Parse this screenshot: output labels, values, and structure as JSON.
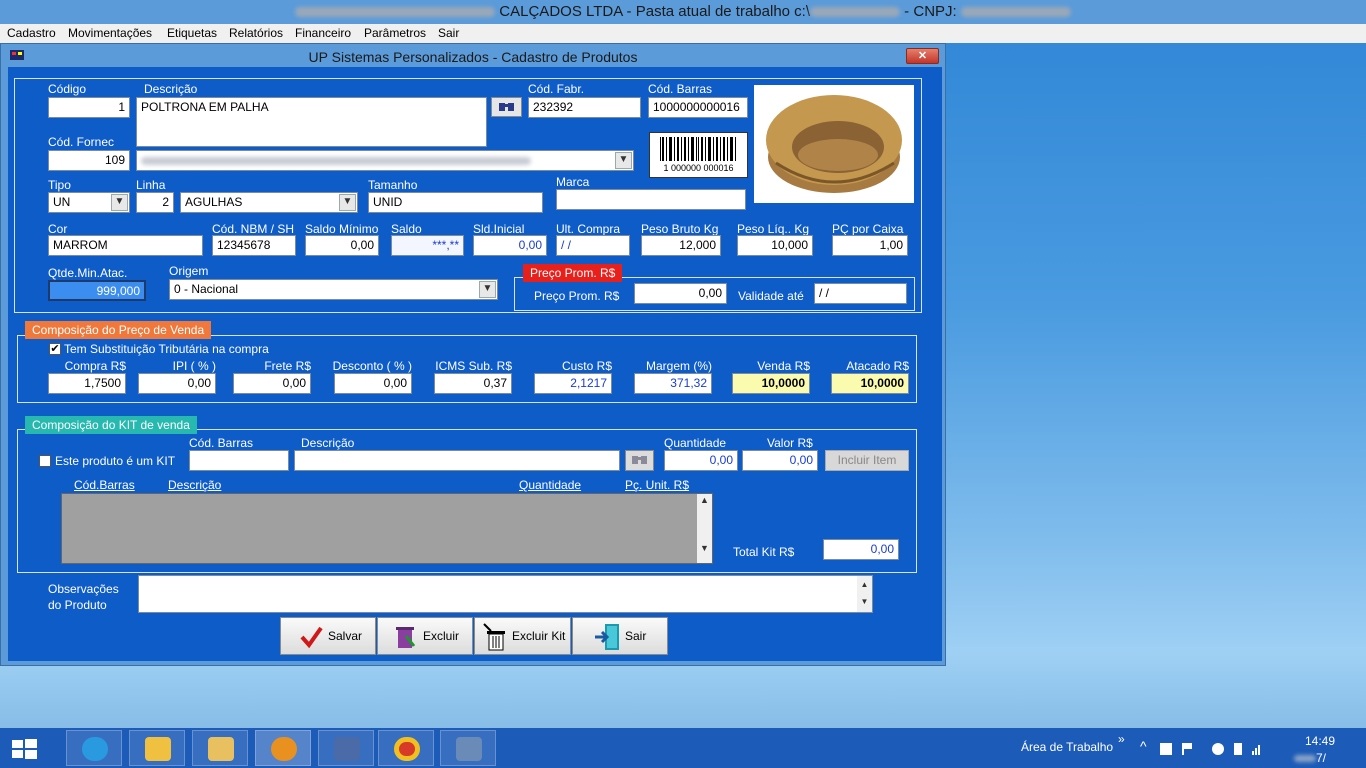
{
  "window": {
    "title_company": "CALÇADOS LTDA",
    "title_path_label": "Pasta atual de trabalho c:\\",
    "title_cnpj_label": "CNPJ:"
  },
  "menu": [
    "Cadastro",
    "Movimentações",
    "Etiquetas",
    "Relatórios",
    "Financeiro",
    "Parâmetros",
    "Sair"
  ],
  "dialog": {
    "title": "UP Sistemas Personalizados - Cadastro de Produtos",
    "close": "✕"
  },
  "product": {
    "codigo_label": "Código",
    "codigo": "1",
    "descricao_label": "Descrição",
    "descricao": "POLTRONA EM PALHA",
    "cod_fabr_label": "Cód. Fabr.",
    "cod_fabr": "232392",
    "cod_barras_label": "Cód. Barras",
    "cod_barras": "1000000000016",
    "barcode_text": "1 000000 000016",
    "cod_fornec_label": "Cód. Fornec",
    "cod_fornec": "109",
    "tipo_label": "Tipo",
    "tipo": "UN",
    "linha_label": "Linha",
    "linha_cod": "2",
    "linha": "AGULHAS",
    "tamanho_label": "Tamanho",
    "tamanho": "UNID",
    "marca_label": "Marca",
    "marca": "",
    "cor_label": "Cor",
    "cor": "MARROM",
    "ncm_label": "Cód. NBM / SH",
    "ncm": "12345678",
    "saldo_min_label": "Saldo Mínimo",
    "saldo_min": "0,00",
    "saldo_label": "Saldo",
    "saldo": "***,**",
    "sld_inicial_label": "Sld.Inicial",
    "sld_inicial": "0,00",
    "ult_compra_label": "Ult. Compra",
    "ult_compra": " / /",
    "peso_bruto_label": "Peso Bruto Kg",
    "peso_bruto": "12,000",
    "peso_liq_label": "Peso Líq.. Kg",
    "peso_liq": "10,000",
    "pc_caixa_label": "PÇ por Caixa",
    "pc_caixa": "1,00",
    "qtde_min_label": "Qtde.Min.Atac.",
    "qtde_min": "999,000",
    "origem_label": "Origem",
    "origem": "0 - Nacional"
  },
  "promo": {
    "tag": "Preço Prom. R$",
    "preco_label": "Preço Prom. R$",
    "preco": "0,00",
    "validade_label": "Validade até",
    "validade": " / /"
  },
  "pricing": {
    "tag": "Composição do Preço de Venda",
    "subst_label": "Tem Substituição Tributária na compra",
    "subst_checked": "✔",
    "compra_label": "Compra R$",
    "compra": "1,7500",
    "ipi_label": "IPI ( % )",
    "ipi": "0,00",
    "frete_label": "Frete R$",
    "frete": "0,00",
    "desconto_label": "Desconto ( % )",
    "desconto": "0,00",
    "icms_label": "ICMS Sub. R$",
    "icms": "0,37",
    "custo_label": "Custo R$",
    "custo": "2,1217",
    "margem_label": "Margem (%)",
    "margem": "371,32",
    "venda_label": "Venda R$",
    "venda": "10,0000",
    "atacado_label": "Atacado R$",
    "atacado": "10,0000"
  },
  "kit": {
    "tag": "Composição do KIT de venda",
    "is_kit_label": "Este produto é um KIT",
    "cod_barras_label": "Cód. Barras",
    "cod_barras": "",
    "descricao_label": "Descrição",
    "descricao": "",
    "quantidade_label": "Quantidade",
    "quantidade": "0,00",
    "valor_label": "Valor R$",
    "valor": "0,00",
    "incluir_label": "Incluir Item",
    "columns": [
      "Cód.Barras",
      "Descrição",
      "Quantidade",
      "Pç. Unit. R$"
    ],
    "total_label": "Total Kit R$",
    "total": "0,00"
  },
  "obs": {
    "label1": "Observações",
    "label2": "do Produto",
    "value": ""
  },
  "buttons": {
    "salvar": "Salvar",
    "excluir": "Excluir",
    "excluir_kit": "Excluir Kit",
    "sair": "Sair"
  },
  "taskbar": {
    "desktop_label": "Área de Trabalho",
    "chevron": "»",
    "time": "14:49",
    "date": "7/"
  },
  "colors": {
    "form_bg": "#0e5cc7",
    "window_bg": "#5b9bd9",
    "promo_tag": "#e8201c",
    "pricing_tag": "#f0783a",
    "kit_tag": "#27b8b0"
  }
}
